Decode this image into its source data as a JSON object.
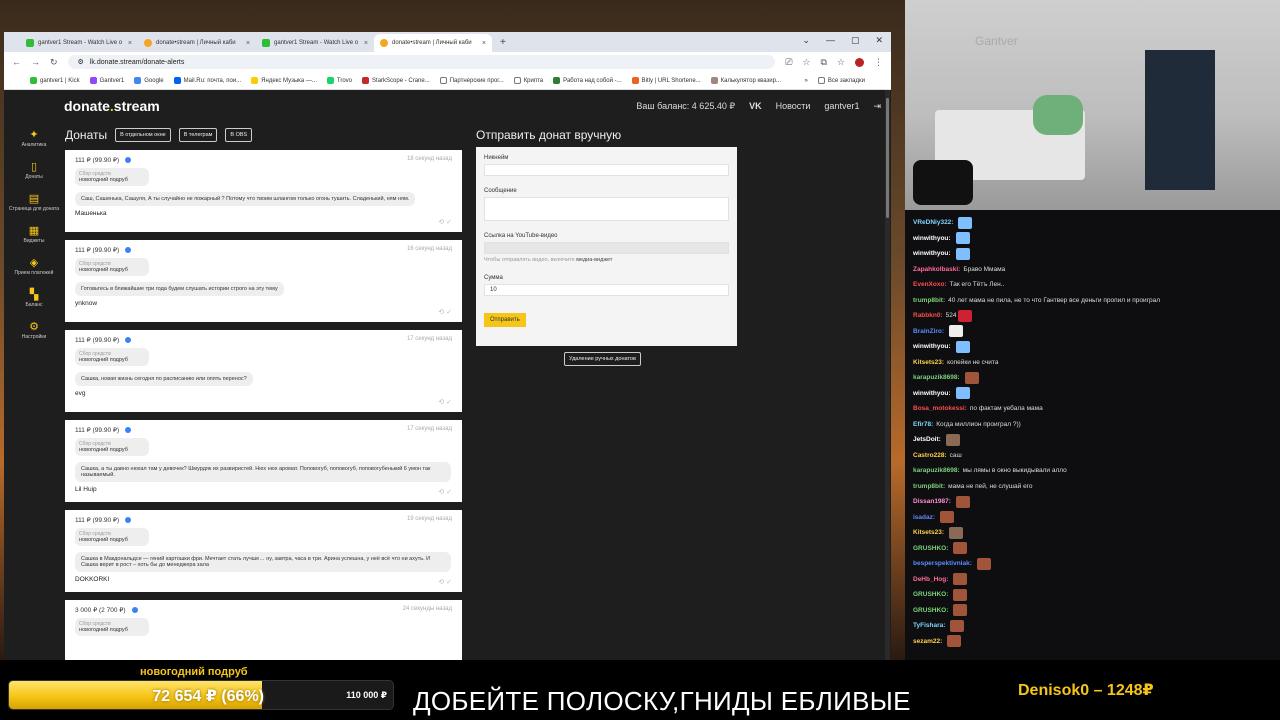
{
  "browser": {
    "tabs": [
      {
        "label": "gantver1 Stream - Watch Live o",
        "fav_color": "#2fbd3a"
      },
      {
        "label": "donate•stream | Личный каби",
        "fav_color": "#f5a623"
      },
      {
        "label": "gantver1 Stream - Watch Live o",
        "fav_color": "#2fbd3a"
      },
      {
        "label": "donate•stream | Личный каби",
        "fav_color": "#f5a623"
      }
    ],
    "new_tab": "+",
    "url": "lk.donate.stream/donate-alerts",
    "bookmarks": [
      "gantver1 | Kick",
      "Gantver1",
      "Google",
      "Mail.Ru: почта, пои...",
      "Яндекс Музыка —...",
      "Trovo",
      "StarkScope - Crane...",
      "Партнерские прог...",
      "Крипта",
      "Работа над собой -...",
      "Bitly | URL Shortene...",
      "Калькулятор квазир..."
    ],
    "all_bookmarks": "Все закладки"
  },
  "site": {
    "logo_a": "donate",
    "logo_dot": ".",
    "logo_b": "stream",
    "balance": "Ваш баланс: 4 625.40 ₽",
    "vk": "VK",
    "news": "Новости",
    "user": "gantver1"
  },
  "sidebar": [
    {
      "icon": "analytics-icon",
      "glyph": "✦",
      "label": "Аналитика"
    },
    {
      "icon": "donations-icon",
      "glyph": "▯",
      "label": "Донаты"
    },
    {
      "icon": "donate-page-icon",
      "glyph": "▤",
      "label": "Страница для доната"
    },
    {
      "icon": "widgets-icon",
      "glyph": "▦",
      "label": "Виджеты"
    },
    {
      "icon": "payments-icon",
      "glyph": "◈",
      "label": "Прием платежей"
    },
    {
      "icon": "balance-icon",
      "glyph": "▚",
      "label": "Баланс"
    },
    {
      "icon": "settings-icon",
      "glyph": "⚙",
      "label": "Настройки"
    }
  ],
  "donations": {
    "title": "Донаты",
    "chips": [
      "В отдельном окне",
      "В телеграм",
      "В OBS"
    ],
    "items": [
      {
        "amount": "111 ₽ (99.90 ₽)",
        "time": "18 секунд назад",
        "goal_label": "Сбор средств",
        "goal": "новогодний подруб",
        "message": "Саш, Сашенька, Сашуля, А ты случайно не пожарный ? Потому что твоим шлангом только огонь тушить. Сладенький, ням ням.",
        "nick": "Машенька"
      },
      {
        "amount": "111 ₽ (99.90 ₽)",
        "time": "16 секунд назад",
        "goal_label": "Сбор средств",
        "goal": "новогодний подруб",
        "message": "Готовьтесь в ближайшие три года будем слушать истории строго на эту тему",
        "nick": "ynknow"
      },
      {
        "amount": "111 ₽ (99.90 ₽)",
        "time": "17 секунд назад",
        "goal_label": "Сбор средств",
        "goal": "новогодний подруб",
        "message": "Сашка, новая жизнь сегодня по расписанию или опять перенос?",
        "nick": "evg"
      },
      {
        "amount": "111 ₽ (99.90 ₽)",
        "time": "17 секунд назад",
        "goal_label": "Сбор средств",
        "goal": "новогодний подруб",
        "message": "Сашка, а ты давно нюхал там у девочек? Шмурдяк их развиристей. Нюх нюх аромат. Поповогуб, поповогуб, поповогубенький 6 умон так называемый.",
        "nick": "Lil Huip"
      },
      {
        "amount": "111 ₽ (99.90 ₽)",
        "time": "19 секунд назад",
        "goal_label": "Сбор средств",
        "goal": "новогодний подруб",
        "message": "Сашка в Макдональдсе — гений картошки фри. Мечтает стать лучше… ну, завтра, часа в три. Арина успешна, у неё всё что ни ахуть. И Сашка верит в рост – хоть бы до менеджера зала",
        "nick": "DOKKORKI"
      },
      {
        "amount": "3 000 ₽ (2 700 ₽)",
        "time": "24 секунды назад",
        "goal_label": "Сбор средств",
        "goal": "новогодний подруб",
        "message": "",
        "nick": ""
      }
    ]
  },
  "manual": {
    "title": "Отправить донат вручную",
    "nick_label": "Никнейм",
    "message_label": "Сообщение",
    "youtube_label": "Ссылка на YouTube-видео",
    "youtube_hint": "Чтобы отправлять видео, включите",
    "youtube_hint_link": "медиа-виджет",
    "sum_label": "Сумма",
    "sum_value": "10",
    "send": "Отправить",
    "delete_manual": "Удаление ручных донатов"
  },
  "cam": {
    "wall_text": "Gantver"
  },
  "chat": [
    {
      "user": "VReDNiy322:",
      "color": "#7fd6ff",
      "text": "",
      "emotes": [
        "#7fbfff"
      ]
    },
    {
      "user": "winwithyou:",
      "color": "#ffffff",
      "text": "",
      "emotes": [
        "#7fbfff"
      ]
    },
    {
      "user": "winwithyou:",
      "color": "#ffffff",
      "text": "",
      "emotes": [
        "#7fbfff"
      ]
    },
    {
      "user": "Zapahkolbaski:",
      "color": "#ff6b9a",
      "text": "Браво Ммама",
      "emotes": []
    },
    {
      "user": "EvenXoxo:",
      "color": "#ff4d4d",
      "text": "Так его Тётъ Лен..",
      "emotes": []
    },
    {
      "user": "trump8bit:",
      "color": "#7cd17c",
      "text": "40 лет мама не пила, не то что Гантвер все деньги пропил и проиграл",
      "emotes": []
    },
    {
      "user": "Rabbkn0:",
      "color": "#ff4d4d",
      "text": "524",
      "emotes": [
        "#cc2233"
      ]
    },
    {
      "user": "BrainZiro:",
      "color": "#5b8cff",
      "text": "",
      "emotes": [
        "#eeeeee"
      ]
    },
    {
      "user": "winwithyou:",
      "color": "#ffffff",
      "text": "",
      "emotes": [
        "#7fbfff"
      ]
    },
    {
      "user": "Kitsets23:",
      "color": "#ffd24d",
      "text": "копейки не считa",
      "emotes": []
    },
    {
      "user": "karapuzik8698:",
      "color": "#7cd17c",
      "text": "",
      "emotes": [
        "#a0553a"
      ]
    },
    {
      "user": "winwithyou:",
      "color": "#ffffff",
      "text": "",
      "emotes": [
        "#7fbfff"
      ]
    },
    {
      "user": "Bosa_motokessi:",
      "color": "#ff4d4d",
      "text": "по фактам уебала мама",
      "emotes": []
    },
    {
      "user": "Efir78:",
      "color": "#7fd6ff",
      "text": "Когда миллион проиграл ?))",
      "emotes": []
    },
    {
      "user": "JetsDoit:",
      "color": "#ffffff",
      "text": "",
      "emotes": [
        "#8a6a55"
      ]
    },
    {
      "user": "Castro228:",
      "color": "#ffd24d",
      "text": "саш",
      "emotes": []
    },
    {
      "user": "karapuzik8698:",
      "color": "#7cd17c",
      "text": "мы лямы в окно выкидывали алло",
      "emotes": []
    },
    {
      "user": "trump8bit:",
      "color": "#7cd17c",
      "text": "мама не пей, не слушай его",
      "emotes": []
    },
    {
      "user": "Dissan1987:",
      "color": "#ff8fd6",
      "text": "",
      "emotes": [
        "#a0553a"
      ]
    },
    {
      "user": "isadaz:",
      "color": "#5b8cff",
      "text": "",
      "emotes": [
        "#a0553a"
      ]
    },
    {
      "user": "Kitsets23:",
      "color": "#ffd24d",
      "text": "",
      "emotes": [
        "#8a6a55"
      ]
    },
    {
      "user": "GRUSHKO:",
      "color": "#7cd17c",
      "text": "",
      "emotes": [
        "#a0553a"
      ]
    },
    {
      "user": "besperspektivniak:",
      "color": "#5b8cff",
      "text": "",
      "emotes": [
        "#a0553a"
      ]
    },
    {
      "user": "DeHb_Hog:",
      "color": "#ff6b9a",
      "text": "",
      "emotes": [
        "#a0553a"
      ]
    },
    {
      "user": "GRUSHKO:",
      "color": "#7cd17c",
      "text": "",
      "emotes": [
        "#a0553a"
      ]
    },
    {
      "user": "GRUSHKO:",
      "color": "#7cd17c",
      "text": "",
      "emotes": [
        "#a0553a"
      ]
    },
    {
      "user": "TyFishara:",
      "color": "#7fd6ff",
      "text": "",
      "emotes": [
        "#a0553a"
      ]
    },
    {
      "user": "sezam22:",
      "color": "#ffd24d",
      "text": "",
      "emotes": [
        "#a0553a"
      ]
    }
  ],
  "goal_bar": {
    "title": "новогодний подруб",
    "current": "72 654 ₽ (66%)",
    "target": "110 000 ₽",
    "progress_fraction": 0.66
  },
  "banner": "ДОБЕЙТЕ ПОЛОСКУ,ГНИДЫ ЕБЛИВЫЕ",
  "top_donator": "Denisok0 – 1248₽",
  "colors": {
    "accent": "#f5c518",
    "page_bg": "#1e1e1e",
    "chat_bg": "#0e0e10"
  }
}
